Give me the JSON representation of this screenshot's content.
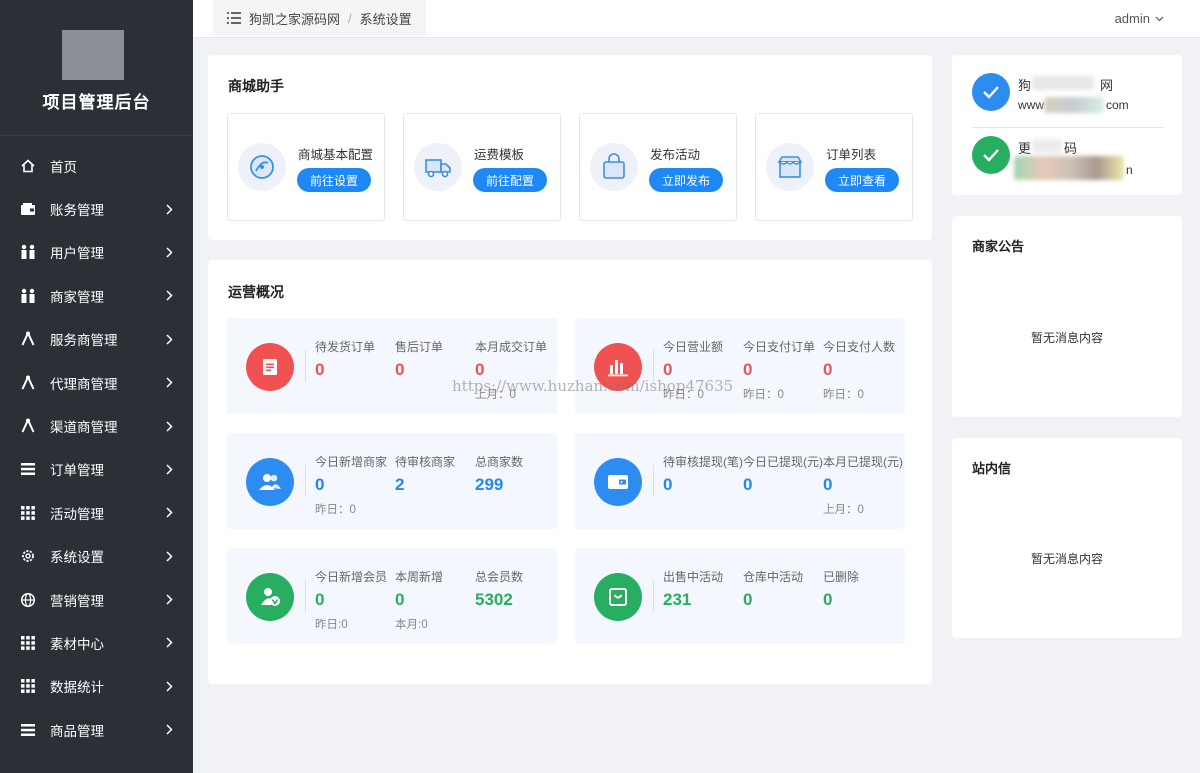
{
  "sidebar": {
    "title": "项目管理后台",
    "items": [
      {
        "label": "首页",
        "icon": "home-icon",
        "has_submenu": false
      },
      {
        "label": "账务管理",
        "icon": "wallet-icon",
        "has_submenu": true
      },
      {
        "label": "用户管理",
        "icon": "users-icon",
        "has_submenu": true
      },
      {
        "label": "商家管理",
        "icon": "users-icon",
        "has_submenu": true
      },
      {
        "label": "服务商管理",
        "icon": "branch-icon",
        "has_submenu": true
      },
      {
        "label": "代理商管理",
        "icon": "branch-icon",
        "has_submenu": true
      },
      {
        "label": "渠道商管理",
        "icon": "branch-icon",
        "has_submenu": true
      },
      {
        "label": "订单管理",
        "icon": "list-icon",
        "has_submenu": true
      },
      {
        "label": "活动管理",
        "icon": "grid-icon",
        "has_submenu": true
      },
      {
        "label": "系统设置",
        "icon": "gear-icon",
        "has_submenu": true
      },
      {
        "label": "营销管理",
        "icon": "globe-icon",
        "has_submenu": true
      },
      {
        "label": "素材中心",
        "icon": "grid-icon",
        "has_submenu": true
      },
      {
        "label": "数据统计",
        "icon": "grid-icon",
        "has_submenu": true
      },
      {
        "label": "商品管理",
        "icon": "list-icon",
        "has_submenu": true
      }
    ]
  },
  "header": {
    "breadcrumb": [
      "狗凯之家源码网",
      "系统设置"
    ],
    "separator": "/",
    "user": "admin"
  },
  "shop_assistant": {
    "title": "商城助手",
    "cards": [
      {
        "label": "商城基本配置",
        "button": "前往设置",
        "icon": "settings-dial-icon"
      },
      {
        "label": "运费模板",
        "button": "前往配置",
        "icon": "truck-icon"
      },
      {
        "label": "发布活动",
        "button": "立即发布",
        "icon": "shopping-bag-icon"
      },
      {
        "label": "订单列表",
        "button": "立即查看",
        "icon": "storefront-icon"
      }
    ]
  },
  "operations": {
    "title": "运营概况",
    "cards": [
      {
        "icon": "document-icon",
        "icon_color": "#f05252",
        "value_color": "red",
        "cols": [
          {
            "label": "待发货订单",
            "value": "0",
            "sub": ""
          },
          {
            "label": "售后订单",
            "value": "0",
            "sub": ""
          },
          {
            "label": "本月成交订单",
            "value": "0",
            "sub": "上月：0"
          }
        ]
      },
      {
        "icon": "bar-chart-icon",
        "icon_color": "#f05252",
        "value_color": "red",
        "cols": [
          {
            "label": "今日营业额",
            "value": "0",
            "sub": "昨日：0"
          },
          {
            "label": "今日支付订单",
            "value": "0",
            "sub": "昨日：0"
          },
          {
            "label": "今日支付人数",
            "value": "0",
            "sub": "昨日：0"
          }
        ]
      },
      {
        "icon": "people-icon",
        "icon_color": "#2d8cf0",
        "value_color": "blue",
        "cols": [
          {
            "label": "今日新增商家",
            "value": "0",
            "sub": "昨日：0"
          },
          {
            "label": "待审核商家",
            "value": "2",
            "sub": ""
          },
          {
            "label": "总商家数",
            "value": "299",
            "sub": ""
          }
        ]
      },
      {
        "icon": "wallet-icon",
        "icon_color": "#2d8cf0",
        "value_color": "blue",
        "cols": [
          {
            "label": "待审核提现(笔)",
            "value": "0",
            "sub": ""
          },
          {
            "label": "今日已提现(元)",
            "value": "0",
            "sub": ""
          },
          {
            "label": "本月已提现(元)",
            "value": "0",
            "sub": "上月：0"
          }
        ]
      },
      {
        "icon": "member-icon",
        "icon_color": "#27ae60",
        "value_color": "green",
        "cols": [
          {
            "label": "今日新增会员",
            "value": "0",
            "sub": "昨日:0"
          },
          {
            "label": "本周新增",
            "value": "0",
            "sub": "本月:0"
          },
          {
            "label": "总会员数",
            "value": "5302",
            "sub": ""
          }
        ]
      },
      {
        "icon": "shopping-bag-icon",
        "icon_color": "#27ae60",
        "value_color": "green",
        "cols": [
          {
            "label": "出售中活动",
            "value": "231",
            "sub": ""
          },
          {
            "label": "仓库中活动",
            "value": "0",
            "sub": ""
          },
          {
            "label": "已删除",
            "value": "0",
            "sub": ""
          }
        ]
      }
    ]
  },
  "watermark": "https://www.huzhan.com/ishop47635",
  "verify": {
    "row1_title": "狗",
    "row1_title_end": "网",
    "row1_url_start": "www",
    "row1_url_end": "com",
    "row2_title_start": "更",
    "row2_title_end": "码",
    "row2_url_end": "n"
  },
  "notice": {
    "title": "商家公告",
    "empty": "暂无消息内容"
  },
  "inbox": {
    "title": "站内信",
    "empty": "暂无消息内容"
  }
}
